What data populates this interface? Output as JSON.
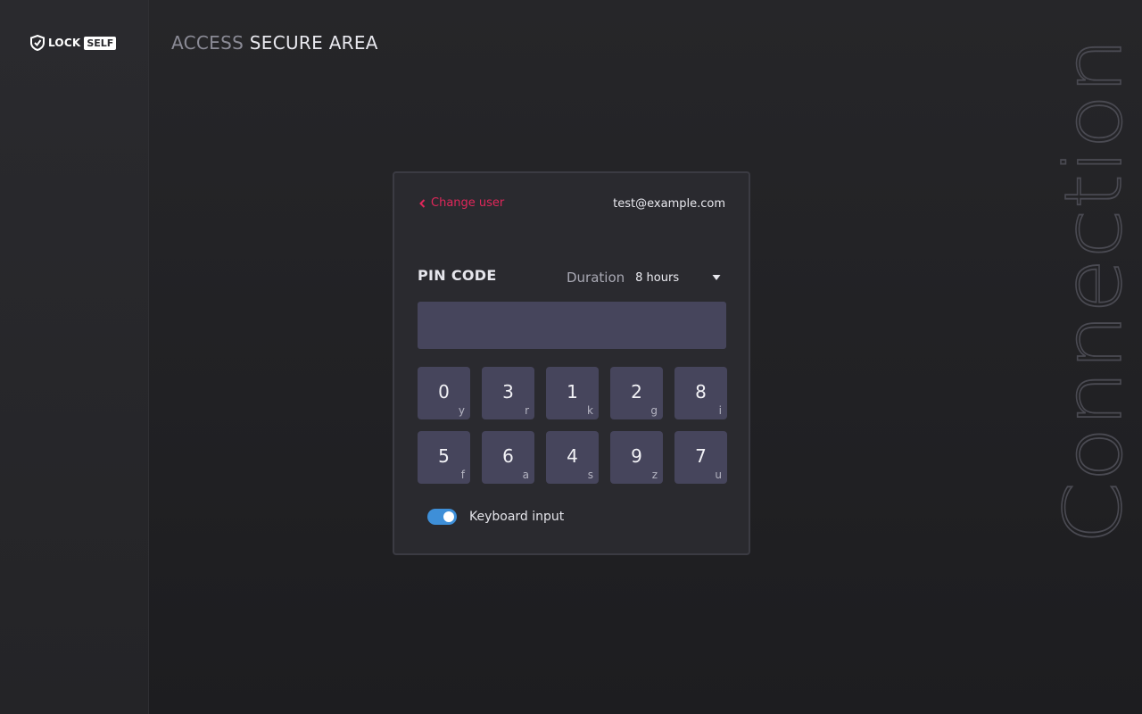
{
  "brand": {
    "name_part1": "LOCK",
    "name_part2": "SELF"
  },
  "header": {
    "title_light": "ACCESS",
    "title_strong": "SECURE AREA"
  },
  "side_word": "Connection",
  "card": {
    "change_user_label": "Change user",
    "user_email": "test@example.com",
    "pin_label": "PIN CODE",
    "duration_label": "Duration",
    "duration_value": "8 hours",
    "pin_value": "",
    "keys": [
      {
        "digit": "0",
        "letter": "y"
      },
      {
        "digit": "3",
        "letter": "r"
      },
      {
        "digit": "1",
        "letter": "k"
      },
      {
        "digit": "2",
        "letter": "g"
      },
      {
        "digit": "8",
        "letter": "i"
      },
      {
        "digit": "5",
        "letter": "f"
      },
      {
        "digit": "6",
        "letter": "a"
      },
      {
        "digit": "4",
        "letter": "s"
      },
      {
        "digit": "9",
        "letter": "z"
      },
      {
        "digit": "7",
        "letter": "u"
      }
    ],
    "keyboard_input_label": "Keyboard input",
    "keyboard_input_enabled": true
  },
  "colors": {
    "accent": "#e0275a",
    "toggle_on": "#3e8fd8",
    "key_bg": "#46455c",
    "card_bg": "#2a2a2f"
  },
  "icons": {
    "logo": "lockself-shield-icon",
    "back": "chevron-left-icon",
    "dropdown": "caret-down-icon"
  }
}
